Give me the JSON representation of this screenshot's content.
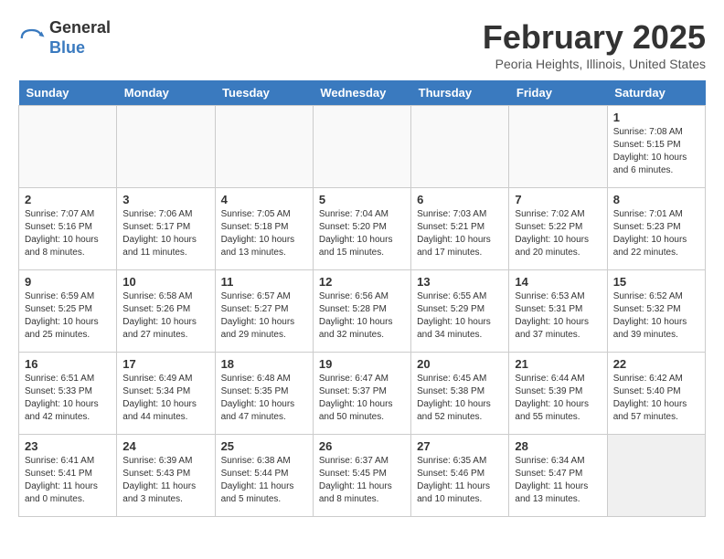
{
  "logo": {
    "line1": "General",
    "line2": "Blue"
  },
  "title": "February 2025",
  "location": "Peoria Heights, Illinois, United States",
  "weekdays": [
    "Sunday",
    "Monday",
    "Tuesday",
    "Wednesday",
    "Thursday",
    "Friday",
    "Saturday"
  ],
  "weeks": [
    [
      {
        "day": "",
        "info": ""
      },
      {
        "day": "",
        "info": ""
      },
      {
        "day": "",
        "info": ""
      },
      {
        "day": "",
        "info": ""
      },
      {
        "day": "",
        "info": ""
      },
      {
        "day": "",
        "info": ""
      },
      {
        "day": "1",
        "info": "Sunrise: 7:08 AM\nSunset: 5:15 PM\nDaylight: 10 hours and 6 minutes."
      }
    ],
    [
      {
        "day": "2",
        "info": "Sunrise: 7:07 AM\nSunset: 5:16 PM\nDaylight: 10 hours and 8 minutes."
      },
      {
        "day": "3",
        "info": "Sunrise: 7:06 AM\nSunset: 5:17 PM\nDaylight: 10 hours and 11 minutes."
      },
      {
        "day": "4",
        "info": "Sunrise: 7:05 AM\nSunset: 5:18 PM\nDaylight: 10 hours and 13 minutes."
      },
      {
        "day": "5",
        "info": "Sunrise: 7:04 AM\nSunset: 5:20 PM\nDaylight: 10 hours and 15 minutes."
      },
      {
        "day": "6",
        "info": "Sunrise: 7:03 AM\nSunset: 5:21 PM\nDaylight: 10 hours and 17 minutes."
      },
      {
        "day": "7",
        "info": "Sunrise: 7:02 AM\nSunset: 5:22 PM\nDaylight: 10 hours and 20 minutes."
      },
      {
        "day": "8",
        "info": "Sunrise: 7:01 AM\nSunset: 5:23 PM\nDaylight: 10 hours and 22 minutes."
      }
    ],
    [
      {
        "day": "9",
        "info": "Sunrise: 6:59 AM\nSunset: 5:25 PM\nDaylight: 10 hours and 25 minutes."
      },
      {
        "day": "10",
        "info": "Sunrise: 6:58 AM\nSunset: 5:26 PM\nDaylight: 10 hours and 27 minutes."
      },
      {
        "day": "11",
        "info": "Sunrise: 6:57 AM\nSunset: 5:27 PM\nDaylight: 10 hours and 29 minutes."
      },
      {
        "day": "12",
        "info": "Sunrise: 6:56 AM\nSunset: 5:28 PM\nDaylight: 10 hours and 32 minutes."
      },
      {
        "day": "13",
        "info": "Sunrise: 6:55 AM\nSunset: 5:29 PM\nDaylight: 10 hours and 34 minutes."
      },
      {
        "day": "14",
        "info": "Sunrise: 6:53 AM\nSunset: 5:31 PM\nDaylight: 10 hours and 37 minutes."
      },
      {
        "day": "15",
        "info": "Sunrise: 6:52 AM\nSunset: 5:32 PM\nDaylight: 10 hours and 39 minutes."
      }
    ],
    [
      {
        "day": "16",
        "info": "Sunrise: 6:51 AM\nSunset: 5:33 PM\nDaylight: 10 hours and 42 minutes."
      },
      {
        "day": "17",
        "info": "Sunrise: 6:49 AM\nSunset: 5:34 PM\nDaylight: 10 hours and 44 minutes."
      },
      {
        "day": "18",
        "info": "Sunrise: 6:48 AM\nSunset: 5:35 PM\nDaylight: 10 hours and 47 minutes."
      },
      {
        "day": "19",
        "info": "Sunrise: 6:47 AM\nSunset: 5:37 PM\nDaylight: 10 hours and 50 minutes."
      },
      {
        "day": "20",
        "info": "Sunrise: 6:45 AM\nSunset: 5:38 PM\nDaylight: 10 hours and 52 minutes."
      },
      {
        "day": "21",
        "info": "Sunrise: 6:44 AM\nSunset: 5:39 PM\nDaylight: 10 hours and 55 minutes."
      },
      {
        "day": "22",
        "info": "Sunrise: 6:42 AM\nSunset: 5:40 PM\nDaylight: 10 hours and 57 minutes."
      }
    ],
    [
      {
        "day": "23",
        "info": "Sunrise: 6:41 AM\nSunset: 5:41 PM\nDaylight: 11 hours and 0 minutes."
      },
      {
        "day": "24",
        "info": "Sunrise: 6:39 AM\nSunset: 5:43 PM\nDaylight: 11 hours and 3 minutes."
      },
      {
        "day": "25",
        "info": "Sunrise: 6:38 AM\nSunset: 5:44 PM\nDaylight: 11 hours and 5 minutes."
      },
      {
        "day": "26",
        "info": "Sunrise: 6:37 AM\nSunset: 5:45 PM\nDaylight: 11 hours and 8 minutes."
      },
      {
        "day": "27",
        "info": "Sunrise: 6:35 AM\nSunset: 5:46 PM\nDaylight: 11 hours and 10 minutes."
      },
      {
        "day": "28",
        "info": "Sunrise: 6:34 AM\nSunset: 5:47 PM\nDaylight: 11 hours and 13 minutes."
      },
      {
        "day": "",
        "info": ""
      }
    ]
  ]
}
